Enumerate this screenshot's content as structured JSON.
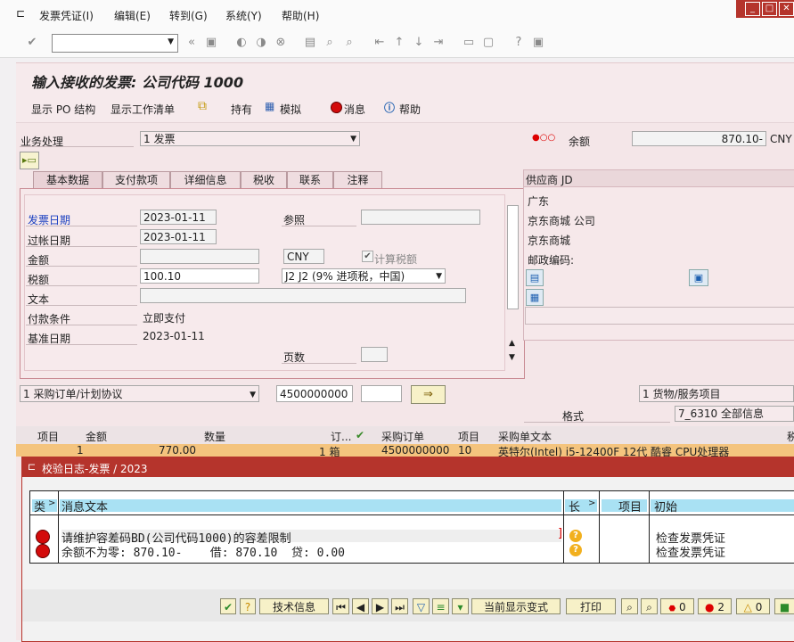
{
  "menu": {
    "items": [
      "发票凭证(I)",
      "编辑(E)",
      "转到(G)",
      "系统(Y)",
      "帮助(H)"
    ]
  },
  "title": "输入接收的发票: 公司代码 1000",
  "app_toolbar": {
    "show_po_structure": "显示 PO 结构",
    "show_worklist": "显示工作清单",
    "hold": "持有",
    "simulate": "模拟",
    "messages": "消息",
    "help": "帮助"
  },
  "header": {
    "transaction_label": "业务处理",
    "transaction_value": "1 发票",
    "balance_label": "余额",
    "balance_value": "870.10-",
    "balance_currency": "CNY"
  },
  "tabs": [
    "基本数据",
    "支付款项",
    "详细信息",
    "税收",
    "联系",
    "注释"
  ],
  "basic_data": {
    "invoice_date_label": "发票日期",
    "invoice_date": "2023-01-11",
    "reference_label": "参照",
    "posting_date_label": "过帐日期",
    "posting_date": "2023-01-11",
    "amount_label": "金额",
    "currency": "CNY",
    "calc_tax_label": "计算税额",
    "tax_label": "税额",
    "tax_amount": "100.10",
    "tax_code": "J2 J2 (9% 进项税，中国)",
    "text_label": "文本",
    "payment_terms_label": "付款条件",
    "payment_terms": "立即支付",
    "baseline_date_label": "基准日期",
    "baseline_date": "2023-01-11",
    "pages_label": "页数"
  },
  "vendor": {
    "header": "供应商 JD",
    "lines": [
      "广东",
      "京东商城 公司",
      "京东商城",
      "邮政编码:"
    ]
  },
  "reference_row": {
    "doc_type": "1 采购订单/计划协议",
    "po_number": "4500000000",
    "layout_label": "格式",
    "item_type": "1 货物/服务项目",
    "layout_value": "7_6310 全部信息"
  },
  "grid": {
    "headers": [
      "项目",
      "金额",
      "数量",
      "订...",
      "采购订单",
      "项目",
      "采购单文本",
      "税"
    ],
    "row": {
      "item": "1",
      "amount": "770.00",
      "qty": "1 箱",
      "po": "4500000000",
      "po_item": "10",
      "text": "英特尔(Intel) i5-12400F 12代 酷睿 CPU处理器"
    }
  },
  "dialog": {
    "title": "校验日志-发票  / 2023",
    "col_type": "类",
    "col_text": "消息文本",
    "col_long": "长",
    "col_item": "项目",
    "col_origin": "初始",
    "messages": [
      {
        "text": "请维护容差码BD(公司代码1000)的容差限制",
        "origin": "检查发票凭证"
      },
      {
        "text": "余额不为零: 870.10-    借: 870.10  贷: 0.00",
        "origin": "检查发票凭证"
      }
    ],
    "footer": {
      "tech_info": "技术信息",
      "current_variant": "当前显示变式",
      "print": "打印",
      "stop_count": "0",
      "error_count": "2",
      "warning_count": "0"
    }
  },
  "colors": {
    "accent": "#b5342c",
    "title_bg": "#f6eaec",
    "grid_row": "#f4c47e"
  }
}
